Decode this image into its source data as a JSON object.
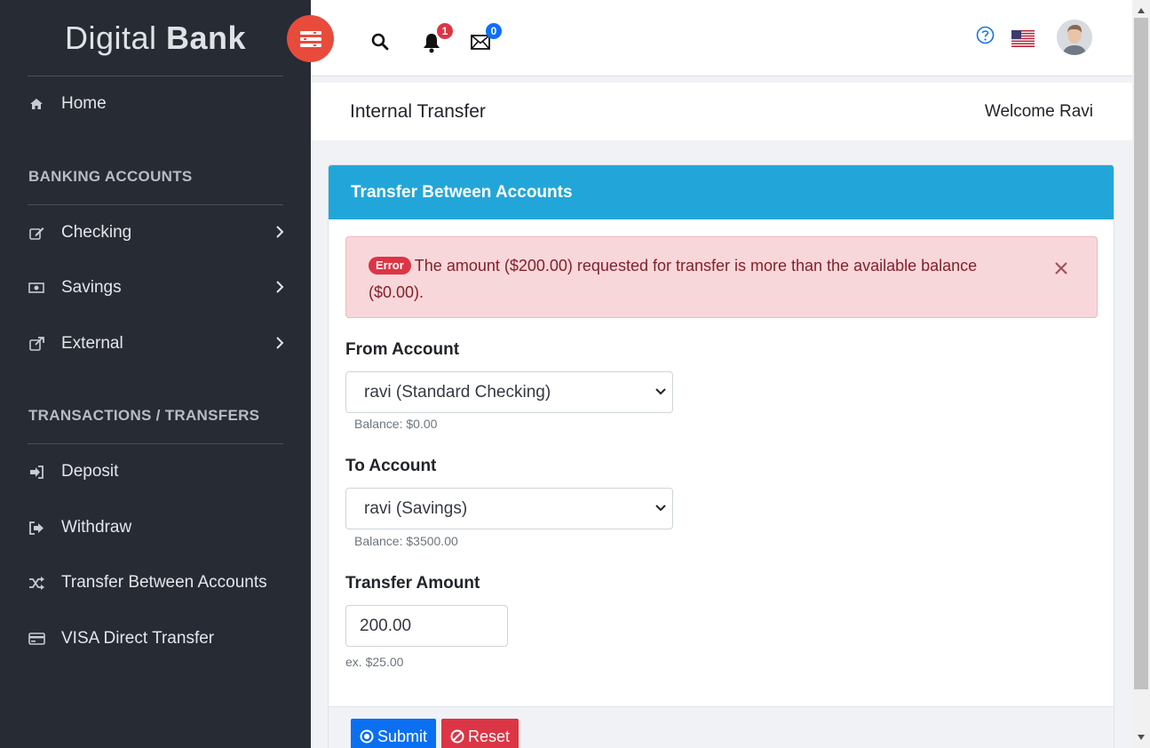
{
  "brand": {
    "light": "Digital",
    "bold": "Bank"
  },
  "sidebar": {
    "home": "Home",
    "banking_heading": "BANKING ACCOUNTS",
    "banking": [
      {
        "label": "Checking",
        "icon": "edit-icon"
      },
      {
        "label": "Savings",
        "icon": "money-icon"
      },
      {
        "label": "External",
        "icon": "external-link-icon"
      }
    ],
    "transactions_heading": "TRANSACTIONS / TRANSFERS",
    "transactions": [
      {
        "label": "Deposit",
        "icon": "sign-in-icon"
      },
      {
        "label": "Withdraw",
        "icon": "sign-out-icon"
      },
      {
        "label": "Transfer Between Accounts",
        "icon": "shuffle-icon"
      },
      {
        "label": "VISA Direct Transfer",
        "icon": "credit-card-icon"
      }
    ]
  },
  "topbar": {
    "notifications_count": "1",
    "messages_count": "0",
    "colors": {
      "menu": "#e84b3c",
      "notif_badge": "#dc3545",
      "msg_badge": "#0d6efd"
    }
  },
  "page": {
    "title": "Internal Transfer",
    "welcome": "Welcome Ravi"
  },
  "card": {
    "title": "Transfer Between Accounts",
    "alert": {
      "badge": "Error",
      "message": "The amount ($200.00) requested for transfer is more than the available balance ($0.00)."
    },
    "from_label": "From Account",
    "from_value": "ravi (Standard Checking)",
    "from_balance": "Balance: $0.00",
    "to_label": "To Account",
    "to_value": "ravi (Savings)",
    "to_balance": "Balance: $3500.00",
    "amount_label": "Transfer Amount",
    "amount_value": "200.00",
    "amount_hint": "ex. $25.00",
    "submit": "Submit",
    "reset": "Reset"
  }
}
